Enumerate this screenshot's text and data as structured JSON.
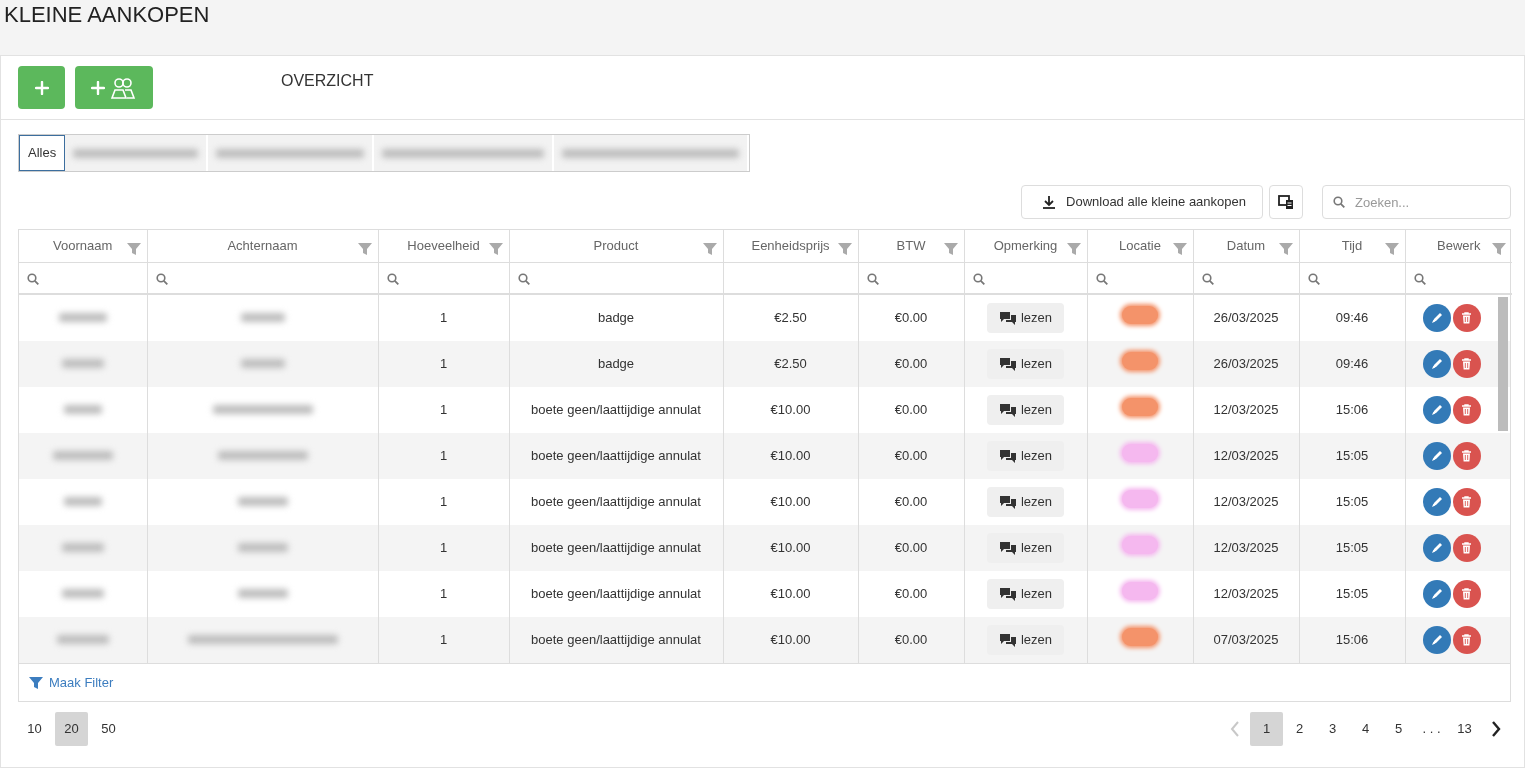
{
  "page": {
    "title": "KLEINE AANKOPEN"
  },
  "toolbar": {
    "heading": "OVERZICHT",
    "buttons": [
      {
        "kind": "add"
      },
      {
        "kind": "add-group"
      }
    ]
  },
  "tabs": [
    {
      "label": "Alles",
      "selected": true
    },
    {
      "selected": false
    },
    {
      "selected": false
    },
    {
      "selected": false
    },
    {
      "selected": false
    }
  ],
  "actions": {
    "download_label": "Download alle kleine aankopen",
    "search": {
      "placeholder": "Zoeken..."
    }
  },
  "table": {
    "columns": [
      {
        "label": "Voornaam",
        "search_field": true
      },
      {
        "label": "Achternaam",
        "search_field": true
      },
      {
        "label": "Hoeveelheid",
        "search_field": true
      },
      {
        "label": "Product",
        "search_field": true
      },
      {
        "label": "Eenheidsprijs",
        "search_field": false
      },
      {
        "label": "BTW",
        "search_field": true
      },
      {
        "label": "Opmerking",
        "search_field": true
      },
      {
        "label": "Locatie",
        "search_field": true
      },
      {
        "label": "Datum",
        "search_field": true
      },
      {
        "label": "Tijd",
        "search_field": true
      },
      {
        "label": "Bewerk",
        "search_field": true
      }
    ],
    "rows": [
      {
        "quantity": "1",
        "product": "badge",
        "unit_price": "€2.50",
        "vat": "€0.00",
        "remark_button": "lezen",
        "color": "#f4936a",
        "date": "26/03/2025",
        "time": "09:46"
      },
      {
        "quantity": "1",
        "product": "badge",
        "unit_price": "€2.50",
        "vat": "€0.00",
        "remark_button": "lezen",
        "color": "#f4936a",
        "date": "26/03/2025",
        "time": "09:46"
      },
      {
        "quantity": "1",
        "product": "boete geen/laattijdige annulat",
        "unit_price": "€10.00",
        "vat": "€0.00",
        "remark_button": "lezen",
        "color": "#f4936a",
        "date": "12/03/2025",
        "time": "15:06"
      },
      {
        "quantity": "1",
        "product": "boete geen/laattijdige annulat",
        "unit_price": "€10.00",
        "vat": "€0.00",
        "remark_button": "lezen",
        "color": "#f5b8ef",
        "date": "12/03/2025",
        "time": "15:05"
      },
      {
        "quantity": "1",
        "product": "boete geen/laattijdige annulat",
        "unit_price": "€10.00",
        "vat": "€0.00",
        "remark_button": "lezen",
        "color": "#f5b8ef",
        "date": "12/03/2025",
        "time": "15:05"
      },
      {
        "quantity": "1",
        "product": "boete geen/laattijdige annulat",
        "unit_price": "€10.00",
        "vat": "€0.00",
        "remark_button": "lezen",
        "color": "#f5b8ef",
        "date": "12/03/2025",
        "time": "15:05"
      },
      {
        "quantity": "1",
        "product": "boete geen/laattijdige annulat",
        "unit_price": "€10.00",
        "vat": "€0.00",
        "remark_button": "lezen",
        "color": "#f5b8ef",
        "date": "12/03/2025",
        "time": "15:05"
      },
      {
        "quantity": "1",
        "product": "boete geen/laattijdige annulat",
        "unit_price": "€10.00",
        "vat": "€0.00",
        "remark_button": "lezen",
        "color": "#f4936a",
        "date": "07/03/2025",
        "time": "15:06"
      }
    ],
    "filter_link": "Maak Filter"
  },
  "page_sizes": [
    {
      "label": "10",
      "selected": false
    },
    {
      "label": "20",
      "selected": true
    },
    {
      "label": "50",
      "selected": false
    }
  ],
  "pagination": {
    "previous_disabled": true,
    "next_disabled": false,
    "pages": [
      {
        "label": "1",
        "selected": true
      },
      {
        "label": "2",
        "selected": false
      },
      {
        "label": "3",
        "selected": false
      },
      {
        "label": "4",
        "selected": false
      },
      {
        "label": "5",
        "selected": false
      },
      {
        "label": ". . .",
        "selected": false
      },
      {
        "label": "13",
        "selected": false
      }
    ]
  }
}
